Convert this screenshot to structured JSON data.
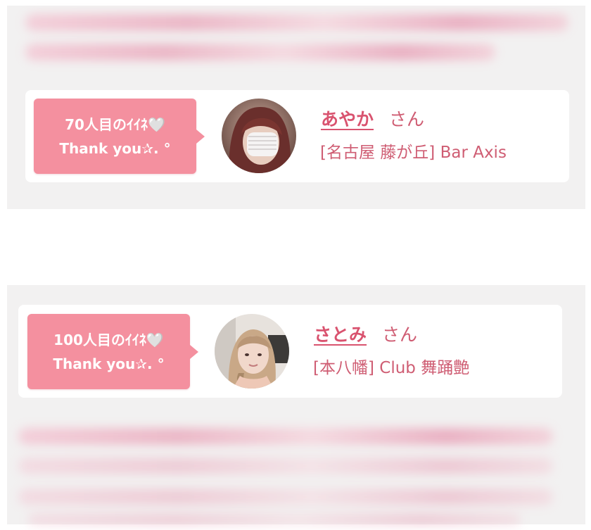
{
  "likes": [
    {
      "badge": {
        "line1": "70人目のｲｲﾈ🤍",
        "line2": "Thank you✰. °"
      },
      "name": "あやか",
      "suffix": "さん",
      "shop": "[名古屋 藤が丘] Bar Axis"
    },
    {
      "badge": {
        "line1": "100人目のｲｲﾈ🤍",
        "line2": "Thank you✰. °"
      },
      "name": "さとみ",
      "suffix": "さん",
      "shop": "[本八幡] Club 舞踊艶"
    }
  ],
  "colors": {
    "badge": "#f4909f",
    "name": "#d9536f",
    "text": "#cf5d73",
    "panel": "#f2f1f1",
    "card": "#ffffff"
  }
}
